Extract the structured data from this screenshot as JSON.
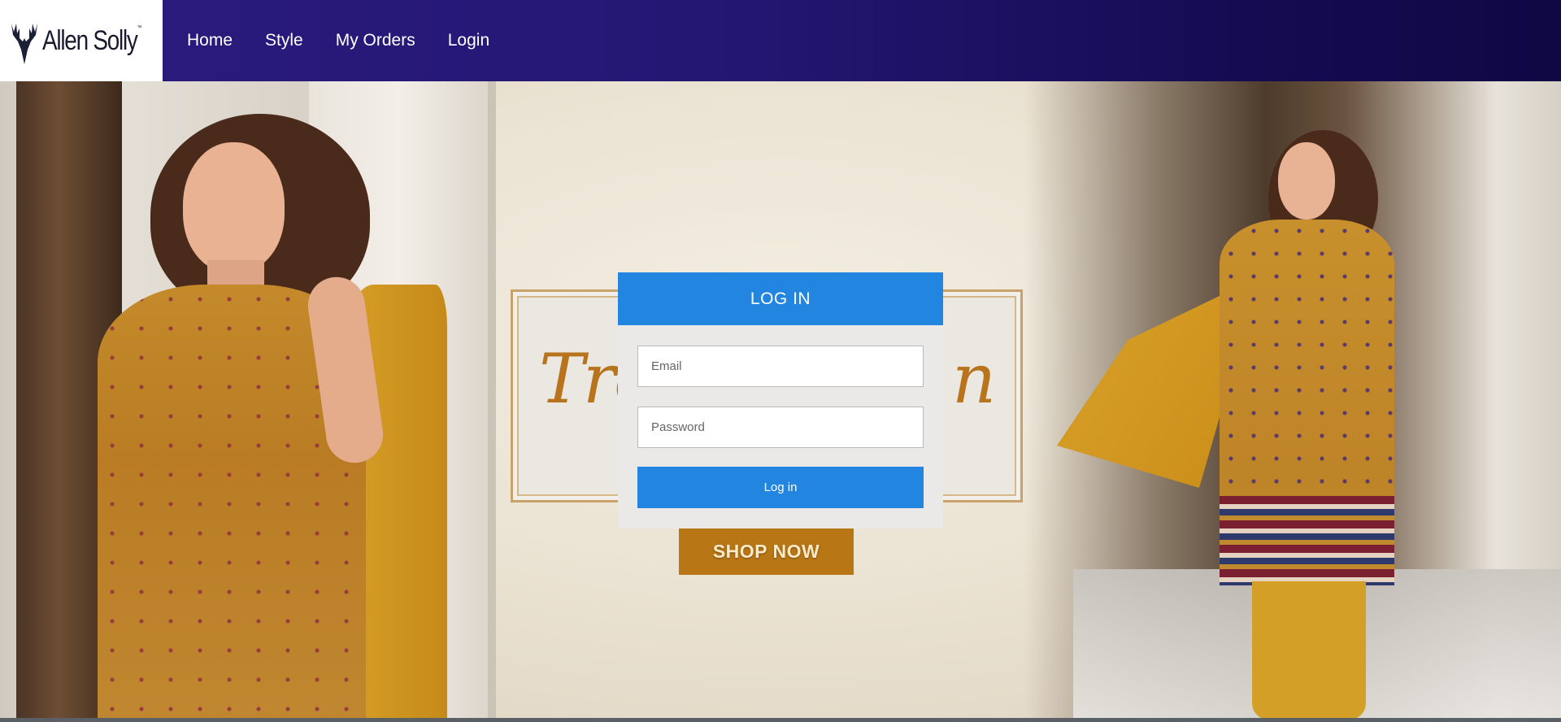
{
  "brand": {
    "logo_text": "Allen Solly",
    "logo_icon": "deer-antlers-icon"
  },
  "nav": {
    "items": [
      {
        "label": "Home"
      },
      {
        "label": "Style"
      },
      {
        "label": "My Orders"
      },
      {
        "label": "Login"
      }
    ]
  },
  "banner": {
    "script_left": "Tre",
    "script_right": "n",
    "cta_label": "SHOP NOW"
  },
  "login": {
    "title": "LOG IN",
    "email_placeholder": "Email",
    "password_placeholder": "Password",
    "submit_label": "Log in"
  },
  "colors": {
    "nav_gradient_start": "#2b1b7e",
    "nav_gradient_end": "#0f0844",
    "primary_blue": "#2285df",
    "panel_bg": "#eae9e8",
    "cta_bg": "#b87615"
  }
}
